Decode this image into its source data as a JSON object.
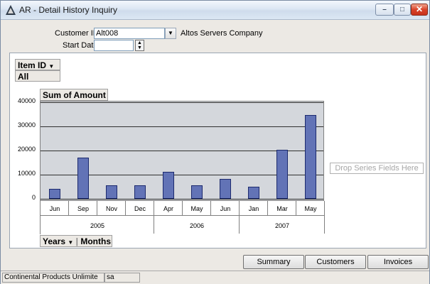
{
  "window": {
    "title": "AR - Detail History Inquiry"
  },
  "form": {
    "customer_id_label": "Customer ID",
    "customer_id_value": "Alt008",
    "customer_name": "Altos Servers Company",
    "start_date_label": "Start Date",
    "start_date_value": ""
  },
  "pivot": {
    "filter_field": "Item ID",
    "filter_value": "All",
    "data_field": "Sum of Amount",
    "row_field_1": "Years",
    "row_field_2": "Months",
    "drop_series_hint": "Drop Series Fields Here"
  },
  "chart_data": {
    "type": "bar",
    "title": "",
    "xlabel": "",
    "ylabel": "Sum of Amount",
    "ylim": [
      0,
      40000
    ],
    "yticks": [
      "40000",
      "30000",
      "20000",
      "10000",
      "0"
    ],
    "categories": [
      "Jun",
      "Sep",
      "Nov",
      "Dec",
      "Apr",
      "May",
      "Jun",
      "Jan",
      "Mar",
      "May"
    ],
    "years": [
      "2005",
      "2006",
      "2007"
    ],
    "values": [
      4200,
      17000,
      5700,
      5700,
      11300,
      5700,
      8300,
      5000,
      20200,
      34800
    ],
    "bar_color": "#6273b6",
    "plot_background": "#d4d7dc",
    "grid": true,
    "legend": "none"
  },
  "buttons": {
    "summary_history": "Summary History",
    "customers": "Customers",
    "invoices": "Invoices"
  },
  "status": {
    "company": "Continental Products Unlimite",
    "user": "sa"
  }
}
